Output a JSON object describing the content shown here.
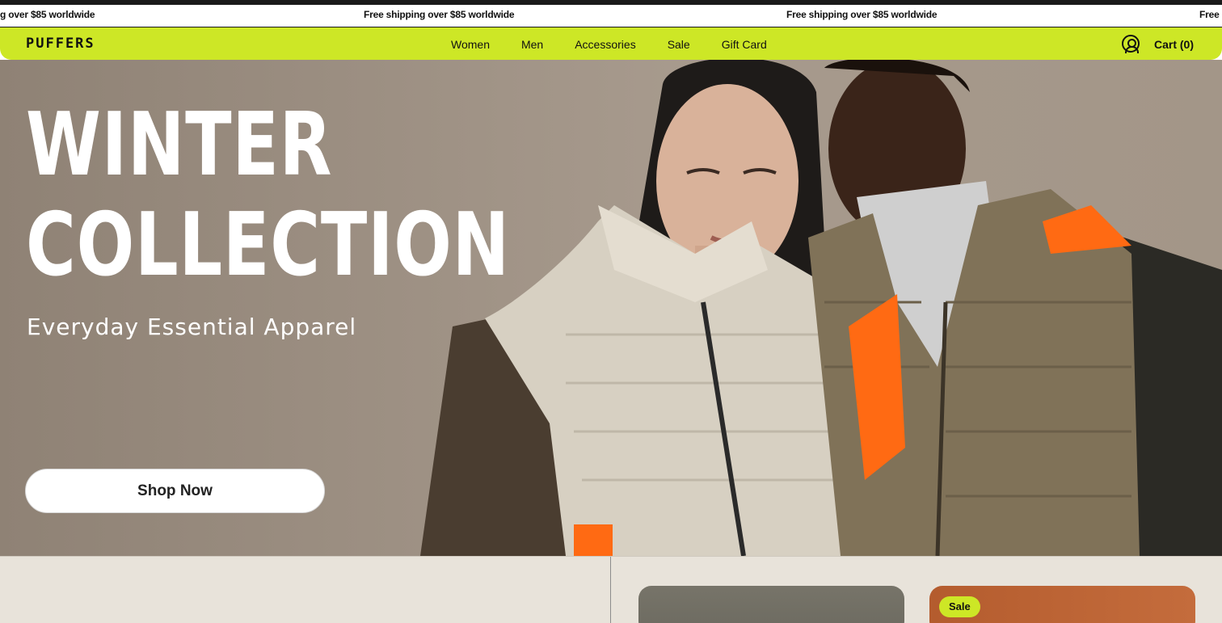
{
  "announcement": {
    "messages": [
      "g over $85 worldwide",
      "Free shipping over $85 worldwide",
      "Free shipping over $85 worldwide",
      "Free"
    ]
  },
  "header": {
    "logo": "PUFFERS",
    "nav": [
      "Women",
      "Men",
      "Accessories",
      "Sale",
      "Gift Card"
    ],
    "account_icon": "user-circle-icon",
    "cart_label": "Cart (0)"
  },
  "hero": {
    "title_line1": "WINTER",
    "title_line2": "COLLECTION",
    "subtitle": "Everyday Essential Apparel",
    "cta_label": "Shop Now"
  },
  "products": {
    "badge": "Sale"
  },
  "colors": {
    "accent": "#cde726",
    "hero_bg": "#9c8f82",
    "orange": "#ff6a13"
  }
}
